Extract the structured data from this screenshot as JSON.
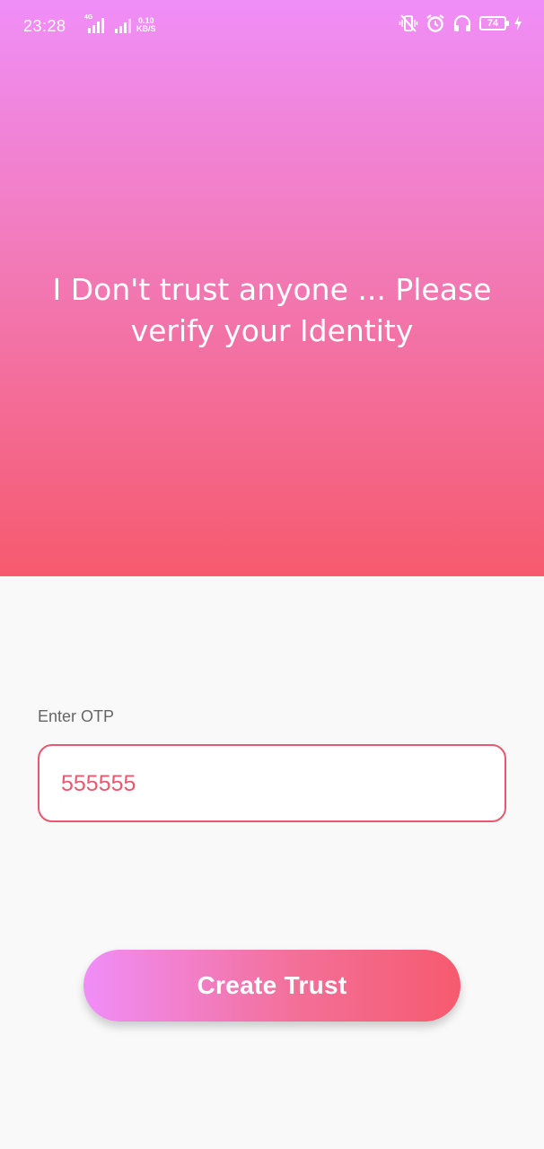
{
  "status_bar": {
    "time": "23:28",
    "signal1_tag": "4G",
    "netspeed_value": "0.10",
    "netspeed_unit": "KB/S",
    "battery": "74",
    "icons": [
      "signal-icon",
      "signal-icon",
      "vibrate-icon",
      "alarm-icon",
      "headphones-icon",
      "battery-icon",
      "charging-icon"
    ]
  },
  "hero": {
    "title": "I Don't trust anyone ... Please verify your Identity"
  },
  "otp": {
    "label": "Enter OTP",
    "value": "555555"
  },
  "actions": {
    "create_trust": "Create Trust"
  },
  "colors": {
    "gradient_start": "#f08ef8",
    "gradient_end": "#f65a6e",
    "accent": "#e8586e",
    "background": "#f9f9f9"
  }
}
